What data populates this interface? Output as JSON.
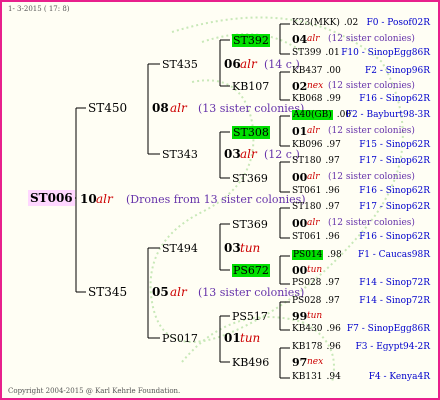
{
  "header": {
    "date": "1- 3-2015 ( 17: 8)"
  },
  "footer": {
    "copyright": "Copyright 2004-2015 @ Karl Kehrle Foundation."
  },
  "root": {
    "name": "ST006",
    "num": "10",
    "tag": "alr",
    "note": "(Drones from 13 sister colonies)"
  },
  "gen1": [
    {
      "name": "ST450",
      "num": "08",
      "tag": "alr",
      "note": "(13 sister colonies)"
    },
    {
      "name": "ST345",
      "num": "05",
      "tag": "alr",
      "note": "(13 sister colonies)"
    }
  ],
  "gen2": [
    {
      "name": "ST435",
      "num": "06",
      "tag": "alr",
      "note": "(14 c.)"
    },
    {
      "name": "ST343",
      "num": "03",
      "tag": "alr",
      "note": "(12 c.)"
    },
    {
      "name": "ST494",
      "num": "03",
      "tag": "tun",
      "note": ""
    },
    {
      "name": "PS017",
      "num": "01",
      "tun": "tun",
      "tag": "tun",
      "note": ""
    }
  ],
  "gen3": [
    {
      "name": "ST392",
      "hl": true,
      "num": "04",
      "tag": "alr",
      "note": "(12 sister colonies)"
    },
    {
      "name": "KB107",
      "hl": false,
      "num": "02",
      "tag": "nex",
      "note": "(12 sister colonies)"
    },
    {
      "name": "ST308",
      "hl": true,
      "num": "01",
      "tag": "alr",
      "note": "(12 sister colonies)"
    },
    {
      "name": "ST369",
      "hl": false,
      "num": "00",
      "tag": "alr",
      "note": "(12 sister colonies)"
    },
    {
      "name": "ST369",
      "hl": false,
      "num": "00",
      "tag": "alr",
      "note": "(12 sister colonies)"
    },
    {
      "name": "PS672",
      "hl": true,
      "num": "00",
      "tag": "tun",
      "note": ""
    },
    {
      "name": "PS517",
      "hl": false,
      "num": "99",
      "tag": "tun",
      "note": ""
    },
    {
      "name": "KB496",
      "hl": false,
      "num": "97",
      "tag": "nex",
      "note": ""
    }
  ],
  "gen4": [
    {
      "name": "K23(MKK)",
      "val": ".02",
      "loc": "F0 - Posof02R",
      "hl": false
    },
    {
      "name": "ST399",
      "val": ".01",
      "loc": "F10 - SinopEgg86R",
      "hl": false
    },
    {
      "name": "KB437",
      "val": ".00",
      "loc": "F2 - Sinop96R",
      "hl": false
    },
    {
      "name": "KB068",
      "val": ".99",
      "loc": "F16 - Sinop62R",
      "hl": false
    },
    {
      "name": "A40(GB)",
      "val": ".00",
      "loc": "F2 - Bayburt98-3R",
      "hl": true
    },
    {
      "name": "KB096",
      "val": ".97",
      "loc": "F15 - Sinop62R",
      "hl": false
    },
    {
      "name": "ST180",
      "val": ".97",
      "loc": "F17 - Sinop62R",
      "hl": false
    },
    {
      "name": "ST061",
      "val": ".96",
      "loc": "F16 - Sinop62R",
      "hl": false
    },
    {
      "name": "ST180",
      "val": ".97",
      "loc": "F17 - Sinop62R",
      "hl": false
    },
    {
      "name": "ST061",
      "val": ".96",
      "loc": "F16 - Sinop62R",
      "hl": false
    },
    {
      "name": "PS014",
      "val": ".98",
      "loc": "F1 - Caucas98R",
      "hl": true
    },
    {
      "name": "PS028",
      "val": ".97",
      "loc": "F14 - Sinop72R",
      "hl": false
    },
    {
      "name": "PS028",
      "val": ".97",
      "loc": "F14 - Sinop72R",
      "hl": false
    },
    {
      "name": "KB430",
      "val": ".96",
      "loc": "F7 - SinopEgg86R",
      "hl": false
    },
    {
      "name": "KB178",
      "val": ".96",
      "loc": "F3 - Egypt94-2R",
      "hl": false
    },
    {
      "name": "KB131",
      "val": ".94",
      "loc": "F4 - Kenya4R",
      "hl": false
    }
  ],
  "colors": {
    "border": "#e8208c",
    "highlight": "#00e000",
    "root_bg": "#ffd7ff",
    "blue": "#0000cc",
    "red": "#cc0000"
  }
}
